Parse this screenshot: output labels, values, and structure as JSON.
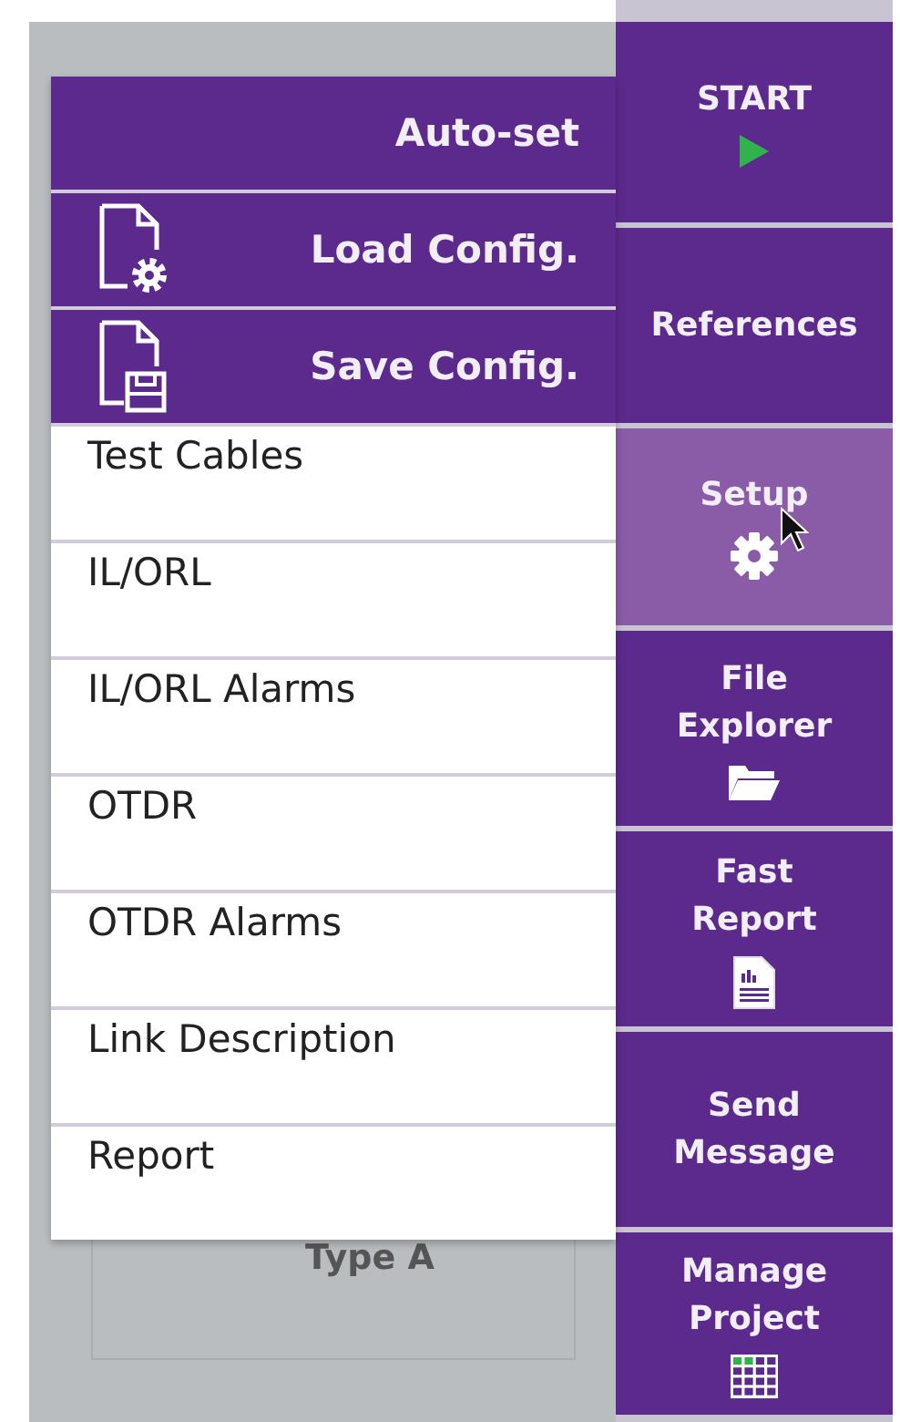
{
  "menu": {
    "header_items": [
      {
        "label": "Auto-set"
      },
      {
        "label": "Load Config."
      },
      {
        "label": "Save Config."
      }
    ],
    "items": [
      {
        "label": "Test Cables"
      },
      {
        "label": "IL/ORL"
      },
      {
        "label": "IL/ORL Alarms"
      },
      {
        "label": "OTDR"
      },
      {
        "label": "OTDR Alarms"
      },
      {
        "label": "Link Description"
      },
      {
        "label": "Report"
      }
    ]
  },
  "background": {
    "label": "Type A"
  },
  "sidebar": [
    {
      "label": "START",
      "selected": false
    },
    {
      "label": "References",
      "selected": false
    },
    {
      "label": "Setup",
      "selected": true
    },
    {
      "label": "File\nExplorer",
      "selected": false
    },
    {
      "label": "Fast\nReport",
      "selected": false
    },
    {
      "label": "Send\nMessage",
      "selected": false
    },
    {
      "label": "Manage\nProject",
      "selected": false
    }
  ]
}
